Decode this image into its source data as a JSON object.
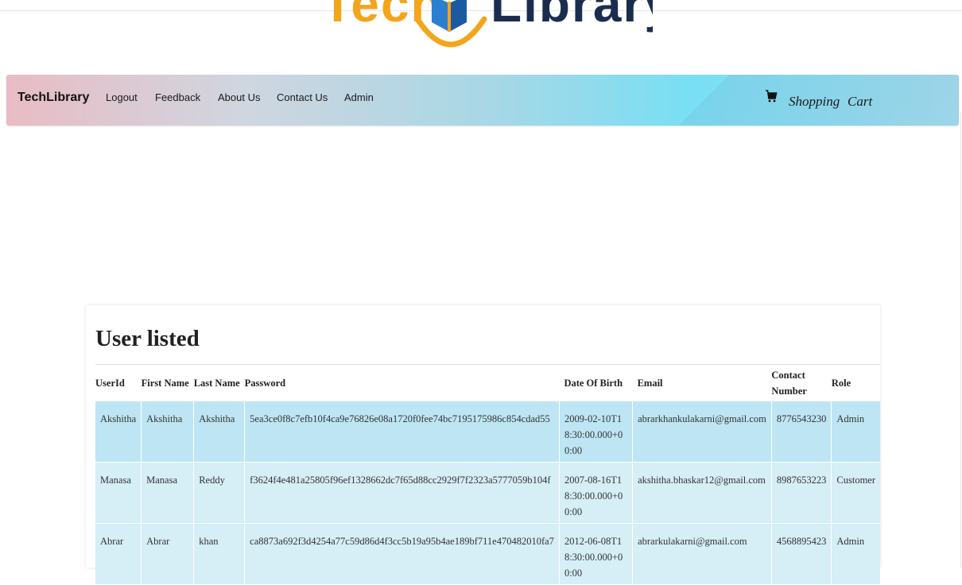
{
  "logo": {
    "word_left": "Tech",
    "word_right": "Library",
    "colors": {
      "orange": "#f3a51b",
      "navy": "#1b2d4f",
      "blue": "#2b7fd0"
    }
  },
  "navbar": {
    "brand": "TechLibrary",
    "items": [
      "Logout",
      "Feedback",
      "About Us",
      "Contact Us",
      "Admin"
    ],
    "cart_icon": "shopping-cart-icon",
    "cart_label_1": "Shopping",
    "cart_label_2": "Cart"
  },
  "main": {
    "heading": "User listed",
    "table": {
      "columns": [
        "UserId",
        "First Name",
        "Last Name",
        "Password",
        "Date Of Birth",
        "Email",
        "Contact Number",
        "Role"
      ],
      "rows": [
        [
          "Akshitha",
          "Akshitha",
          "Akshitha",
          "5ea3ce0f8c7efb10f4ca9e76826e08a1720f0fee74bc7195175986c854cdad55",
          "2009-02-10T18:30:00.000+00:00",
          "abrarkhankulakarni@gmail.com",
          "8776543230",
          "Admin"
        ],
        [
          "Manasa",
          "Manasa",
          "Reddy",
          "f3624f4e481a25805f96ef1328662dc7f65d88cc2929f7f2323a5777059b104f",
          "2007-08-16T18:30:00.000+00:00",
          "akshitha.bhaskar12@gmail.com",
          "8987653223",
          "Customer"
        ],
        [
          "Abrar",
          "Abrar",
          "khan",
          "ca8873a692f3d4254a77c59d86d4f3cc5b19a95b4ae189bf711e470482010fa7",
          "2012-06-08T18:30:00.000+00:00",
          "abrarkulakarni@gmail.com",
          "4568895423",
          "Admin"
        ]
      ]
    }
  }
}
